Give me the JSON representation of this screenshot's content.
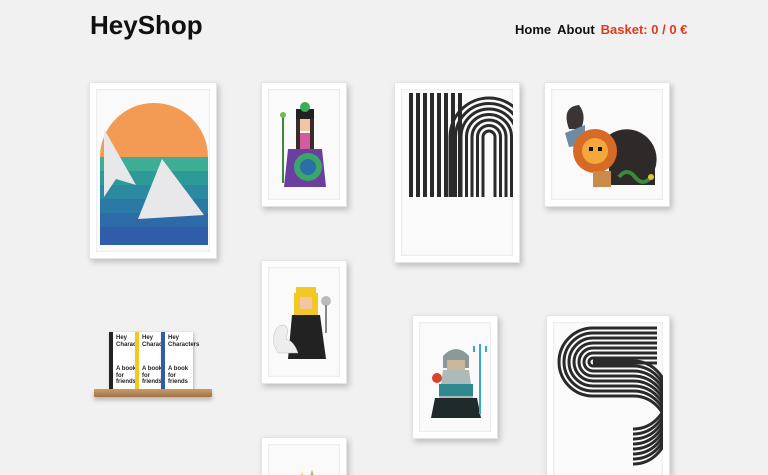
{
  "header": {
    "logo": "HeyShop",
    "nav": {
      "home": "Home",
      "about": "About",
      "basket": "Basket: 0 / 0 €"
    }
  },
  "books": {
    "title_line1": "Hey",
    "title_line2": "Characters",
    "tagline_line1": "A book",
    "tagline_line2": "for friends"
  },
  "colors": {
    "background": "#f1f1f1",
    "accent": "#e03a1e",
    "sunset_orange": "#f39a55",
    "teal": "#3dae93",
    "blue": "#2f5da8",
    "yellow": "#f3c823"
  },
  "artworks": [
    {
      "name": "sunset-mountains-print"
    },
    {
      "name": "peacock-queen-print"
    },
    {
      "name": "striped-h-print"
    },
    {
      "name": "lion-goat-chimera-print"
    },
    {
      "name": "swan-goddess-print"
    },
    {
      "name": "poseidon-trident-print"
    },
    {
      "name": "striped-s-print"
    },
    {
      "name": "partial-bottom-print"
    }
  ]
}
